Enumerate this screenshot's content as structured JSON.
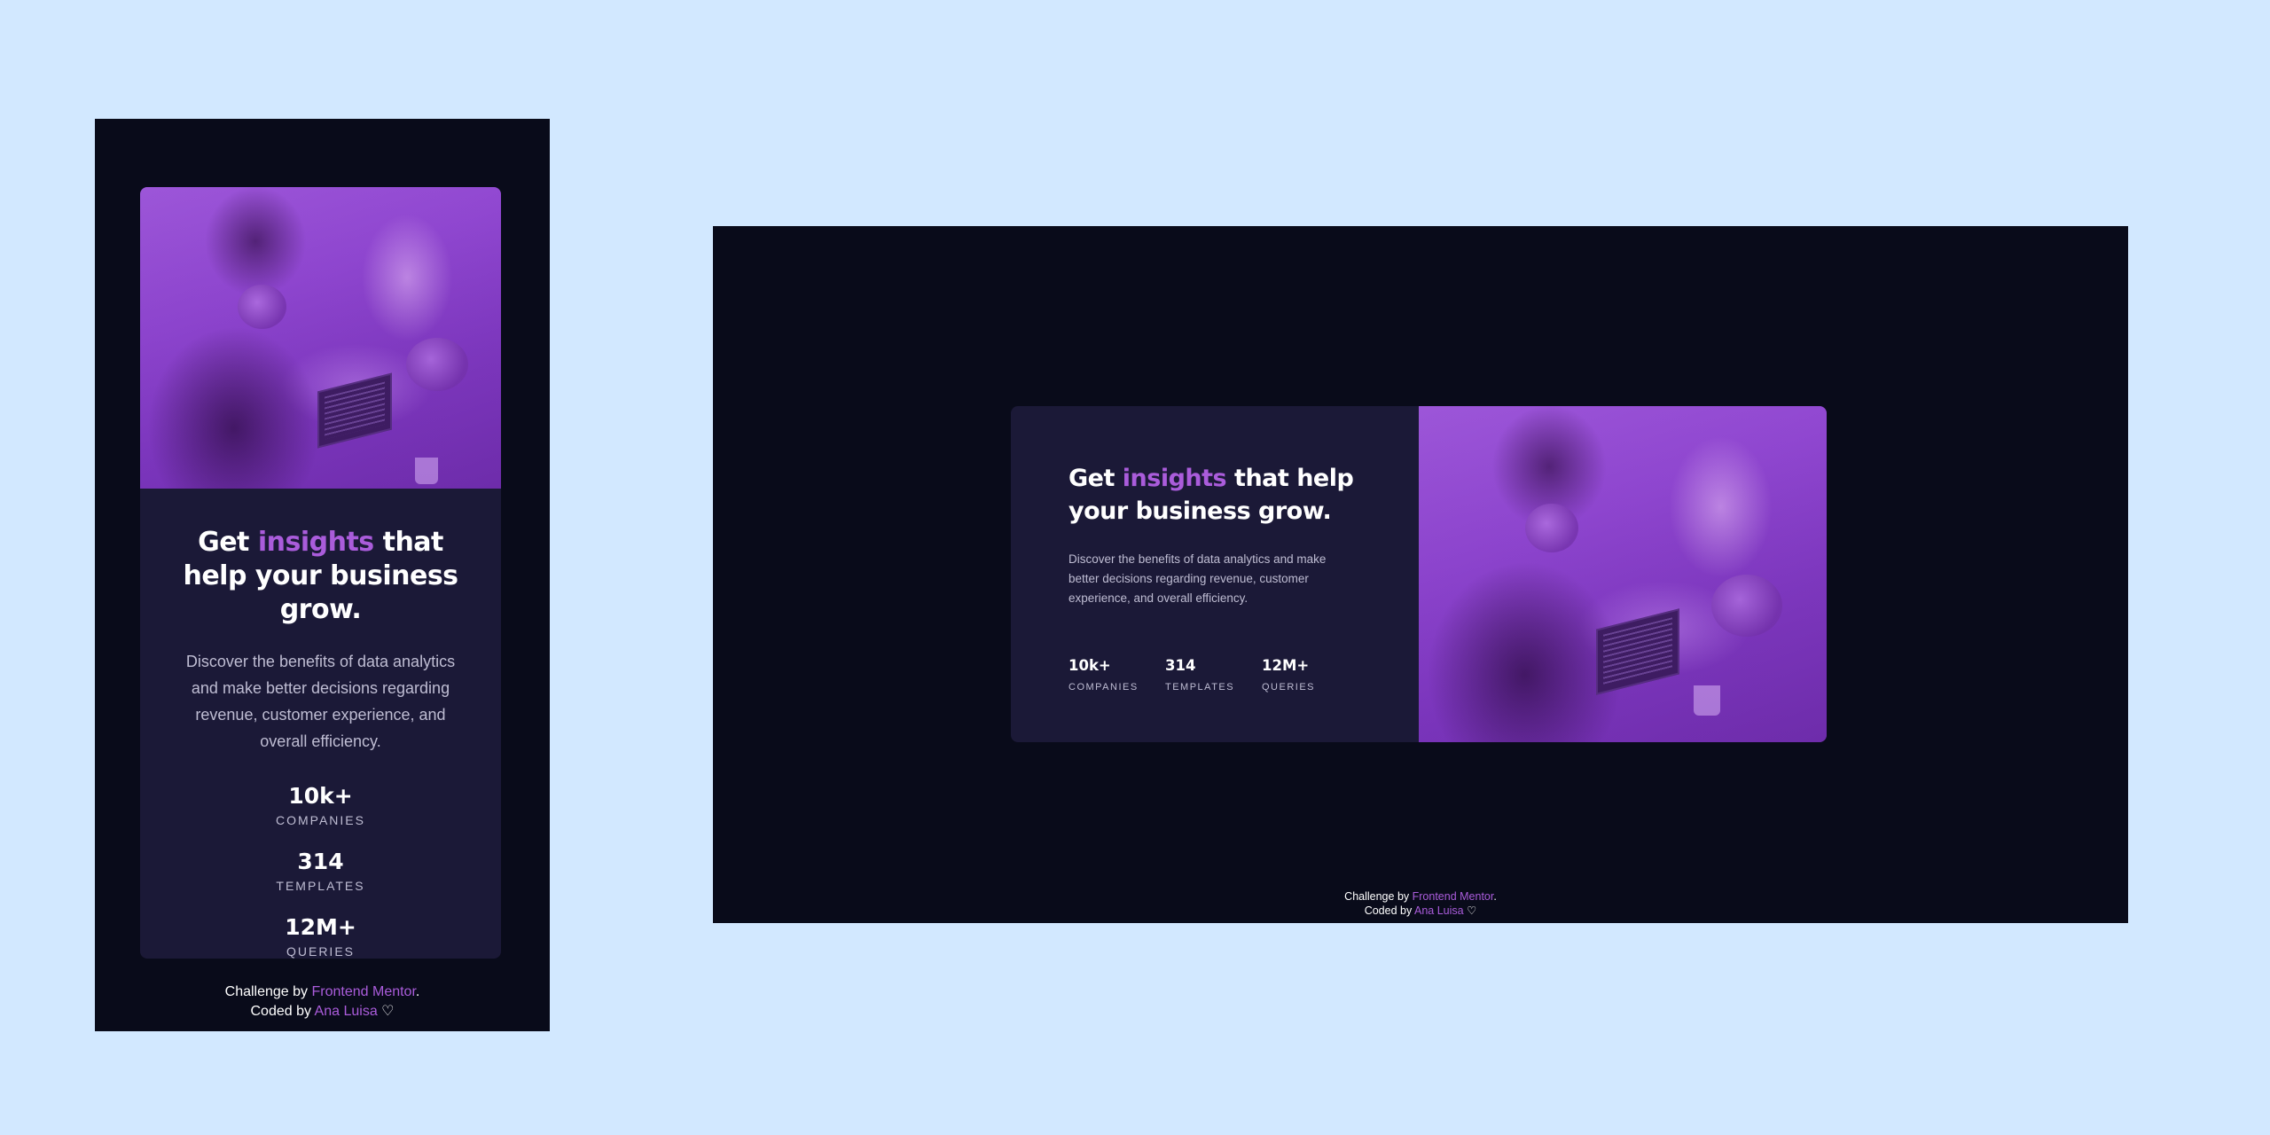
{
  "headline": {
    "pre": "Get",
    "accent": "insights",
    "post": "that help your business grow."
  },
  "description": "Discover the benefits of data analytics and make better decisions regarding revenue, customer experience, and overall efficiency.",
  "stats": [
    {
      "value": "10k+",
      "label": "COMPANIES"
    },
    {
      "value": "314",
      "label": "TEMPLATES"
    },
    {
      "value": "12M+",
      "label": "QUERIES"
    }
  ],
  "footer": {
    "challenge_text": "Challenge by",
    "challenge_link": "Frontend Mentor",
    "challenge_end": ".",
    "coded_text": "Coded by",
    "coded_link": "Ana Luisa",
    "heart": "♡"
  },
  "colors": {
    "page_background": "#d2e8ff",
    "frame_background": "#090b1a",
    "card_background": "#1b1937",
    "accent": "#aa5cdb",
    "muted_text": "#bfbdd3"
  },
  "icons": {
    "heart": "heart-icon"
  }
}
